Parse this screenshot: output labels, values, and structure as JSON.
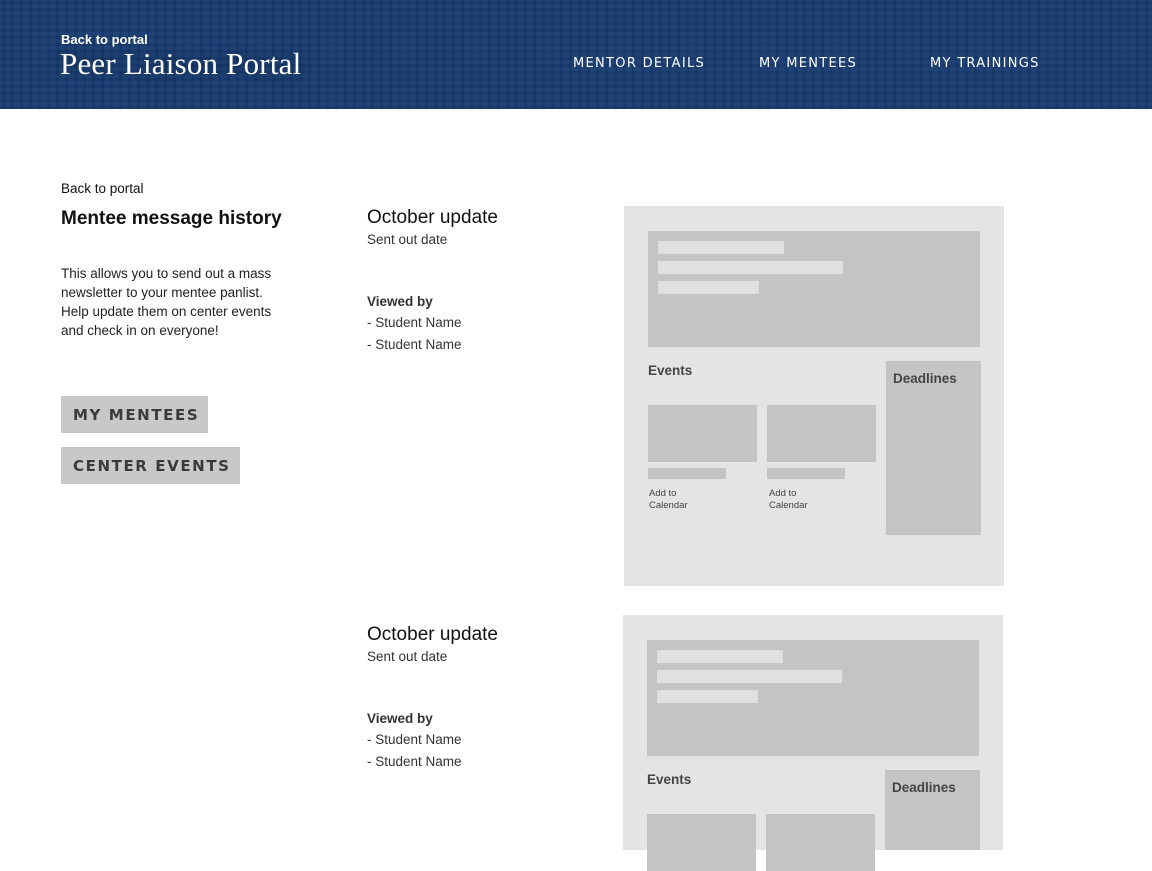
{
  "header": {
    "back_label": "Back to portal",
    "title": "Peer Liaison Portal",
    "nav": [
      "MENTOR DETAILS",
      "MY MENTEES",
      "MY TRAININGS"
    ],
    "background_color": "#173a6f"
  },
  "sidebar": {
    "back_label": "Back to portal",
    "title": "Mentee message history",
    "description": "This allows you to send out a mass newsletter to your mentee panlist. Help update them on center events and check in on everyone!",
    "buttons": [
      "MY MENTEES",
      "CENTER EVENTS"
    ]
  },
  "updates": [
    {
      "title": "October update",
      "sent_label": "Sent out date",
      "viewed_label": "Viewed by",
      "viewers": [
        "- Student Name",
        "- Student Name"
      ],
      "preview": {
        "events_label": "Events",
        "deadlines_label": "Deadlines",
        "add_to_calendar": [
          "Add to\nCalendar",
          "Add to\nCalendar"
        ]
      }
    },
    {
      "title": "October update",
      "sent_label": "Sent out date",
      "viewed_label": "Viewed by",
      "viewers": [
        "- Student Name",
        "- Student Name"
      ],
      "preview": {
        "events_label": "Events",
        "deadlines_label": "Deadlines"
      }
    }
  ]
}
